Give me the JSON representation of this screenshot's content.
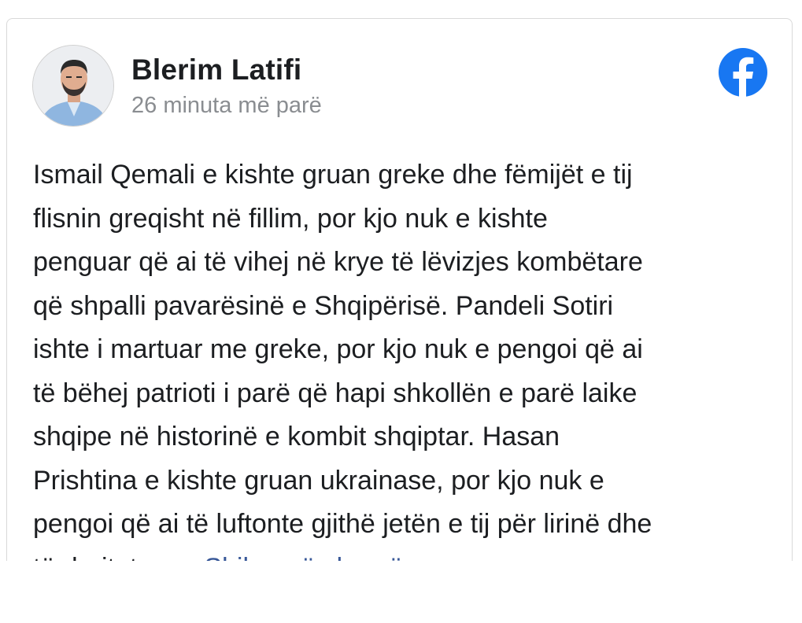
{
  "post": {
    "author_name": "Blerim Latifi",
    "timestamp": "26 minuta më parë",
    "body_lines": [
      "Ismail Qemali e kishte gruan greke dhe fëmijët e tij",
      "flisnin greqisht në fillim, por kjo nuk e kishte",
      "penguar që ai të vihej në krye të lëvizjes kombëtare",
      "që shpalli pavarësinë e Shqipërisë. Pandeli Sotiri",
      "ishte i martuar me greke, por kjo nuk e pengoi që ai",
      "të bëhej patrioti i parë që hapi shkollën e parë laike",
      "shqipe në historinë e kombit shqiptar. Hasan",
      "Prishtina e kishte gruan ukrainase, por kjo nuk e",
      "pengoi që ai të luftonte gjithë jetën e tij për lirinë dhe"
    ],
    "truncated_line_text": "të drejtat e...",
    "see_more_label": "Shiko më shumë"
  },
  "icons": {
    "avatar": "avatar",
    "platform": "facebook-icon"
  },
  "colors": {
    "facebook_blue": "#1877f2",
    "link_blue": "#385898",
    "text_primary": "#1c1e21",
    "text_secondary": "#8a8d91"
  }
}
